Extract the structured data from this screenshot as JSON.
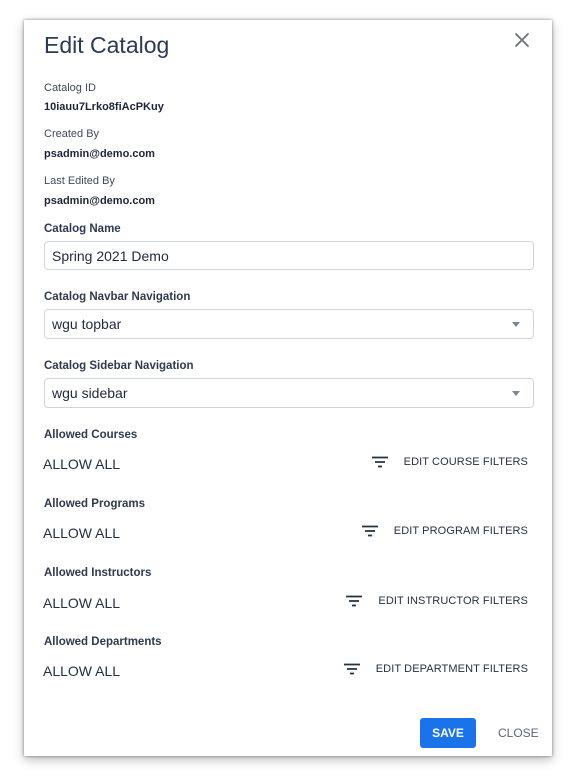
{
  "dialog": {
    "title": "Edit Catalog",
    "close_icon": "close-icon"
  },
  "meta": {
    "catalog_id_label": "Catalog ID",
    "catalog_id_value": "10iauu7Lrko8fiAcPKuy",
    "created_by_label": "Created By",
    "created_by_value": "psadmin@demo.com",
    "last_edited_label": "Last Edited By",
    "last_edited_value": "psadmin@demo.com"
  },
  "form": {
    "catalog_name_label": "Catalog Name",
    "catalog_name_value": "Spring 2021 Demo",
    "navbar_label": "Catalog Navbar Navigation",
    "navbar_value": "wgu topbar",
    "sidebar_label": "Catalog Sidebar Navigation",
    "sidebar_value": "wgu sidebar"
  },
  "allowed": [
    {
      "label": "Allowed Courses",
      "value": "ALLOW ALL",
      "button": "EDIT COURSE FILTERS"
    },
    {
      "label": "Allowed Programs",
      "value": "ALLOW ALL",
      "button": "EDIT PROGRAM FILTERS"
    },
    {
      "label": "Allowed Instructors",
      "value": "ALLOW ALL",
      "button": "EDIT INSTRUCTOR FILTERS"
    },
    {
      "label": "Allowed Departments",
      "value": "ALLOW ALL",
      "button": "EDIT DEPARTMENT FILTERS"
    }
  ],
  "actions": {
    "save": "SAVE",
    "close": "CLOSE"
  },
  "colors": {
    "primary": "#1a73e8",
    "title": "#2b3a55"
  }
}
